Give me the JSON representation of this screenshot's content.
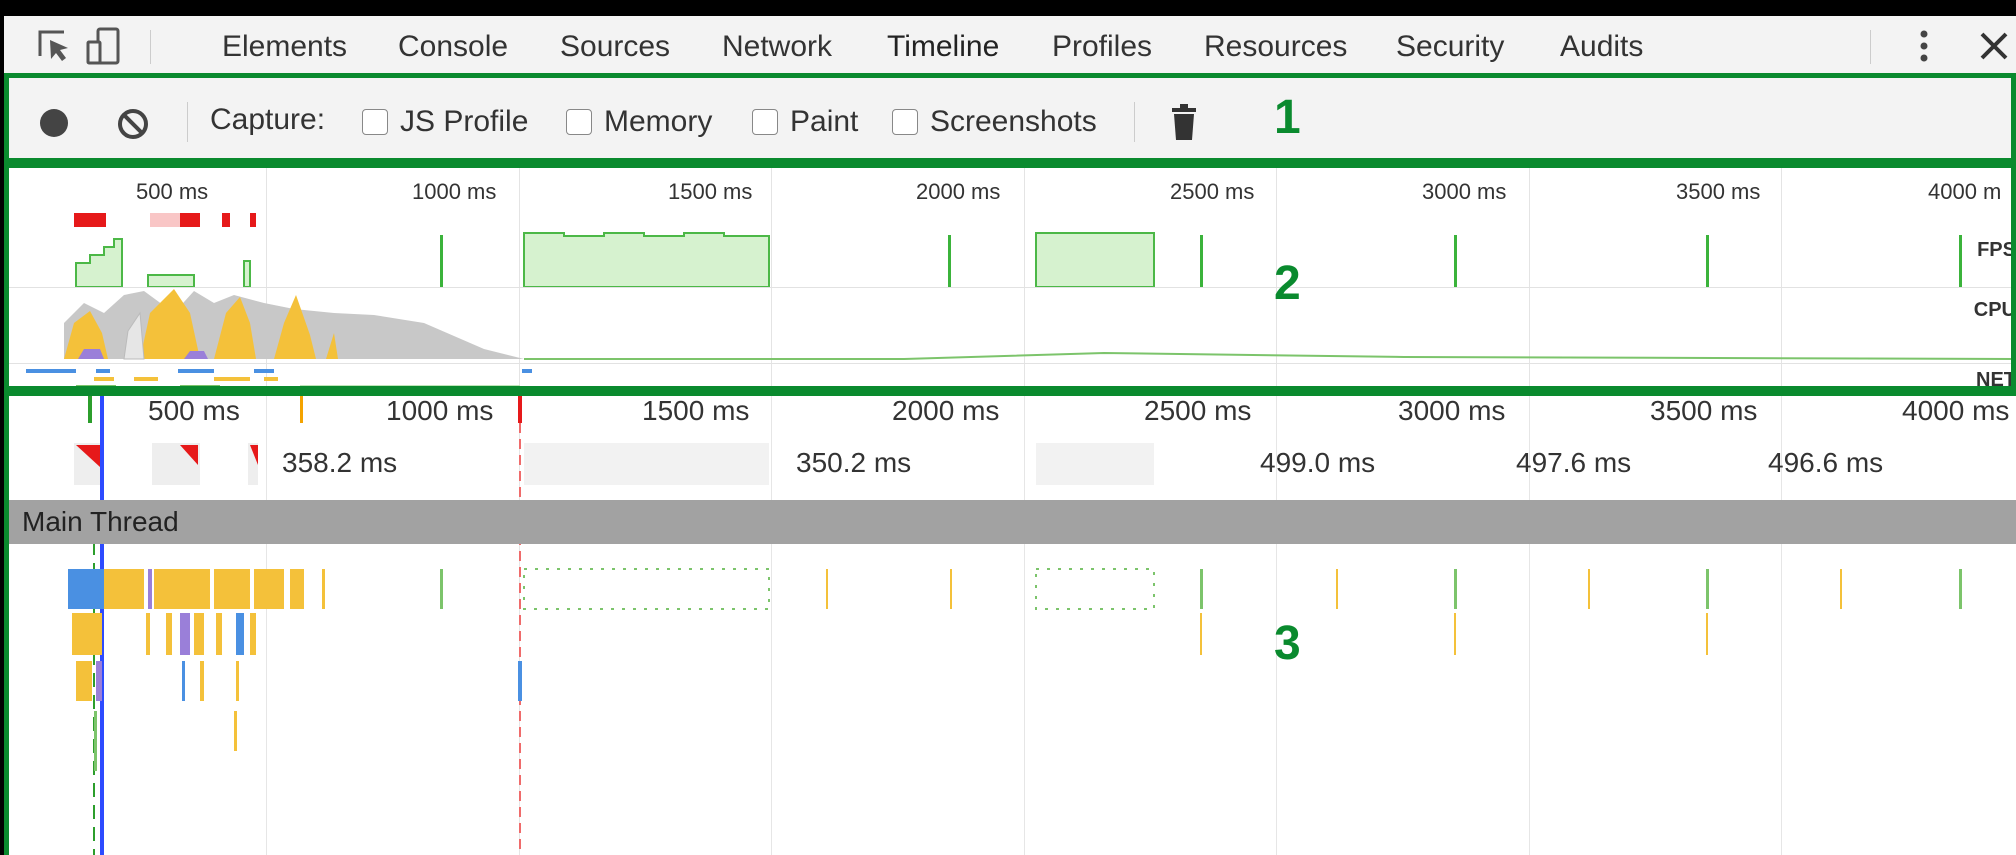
{
  "tabs": [
    {
      "label": "Elements",
      "active": false
    },
    {
      "label": "Console",
      "active": false
    },
    {
      "label": "Sources",
      "active": false
    },
    {
      "label": "Network",
      "active": false
    },
    {
      "label": "Timeline",
      "active": true
    },
    {
      "label": "Profiles",
      "active": false
    },
    {
      "label": "Resources",
      "active": false
    },
    {
      "label": "Security",
      "active": false
    },
    {
      "label": "Audits",
      "active": false
    }
  ],
  "icons": {
    "inspect": "inspect-element-icon",
    "device": "device-mode-icon",
    "menu": "more-vertical-icon",
    "close": "close-icon",
    "record": "record-icon",
    "clear": "clear-icon",
    "trash": "trash-icon"
  },
  "toolbar": {
    "capture_label": "Capture:",
    "checkboxes": [
      {
        "label": "JS Profile",
        "checked": false
      },
      {
        "label": "Memory",
        "checked": false
      },
      {
        "label": "Paint",
        "checked": false
      },
      {
        "label": "Screenshots",
        "checked": false
      }
    ]
  },
  "overview": {
    "ticks": [
      "500 ms",
      "1000 ms",
      "1500 ms",
      "2000 ms",
      "2500 ms",
      "3000 ms",
      "3500 ms",
      "4000 m"
    ],
    "rows": [
      "FPS",
      "CPU",
      "NET"
    ]
  },
  "flame": {
    "ticks": [
      "500 ms",
      "1000 ms",
      "1500 ms",
      "2000 ms",
      "2500 ms",
      "3000 ms",
      "3500 ms",
      "4000 ms"
    ],
    "frame_durations": [
      "358.2 ms",
      "350.2 ms",
      "499.0 ms",
      "497.6 ms",
      "496.6 ms"
    ],
    "track_title": "Main Thread"
  },
  "annotations": [
    "1",
    "2",
    "3"
  ],
  "colors": {
    "annotation": "#0a8a2e",
    "scripting": "#f4c13a",
    "rendering": "#9a7fd9",
    "loading": "#4a90e2",
    "painting": "#7cc46b",
    "fps_fill": "#d6f2cf"
  }
}
